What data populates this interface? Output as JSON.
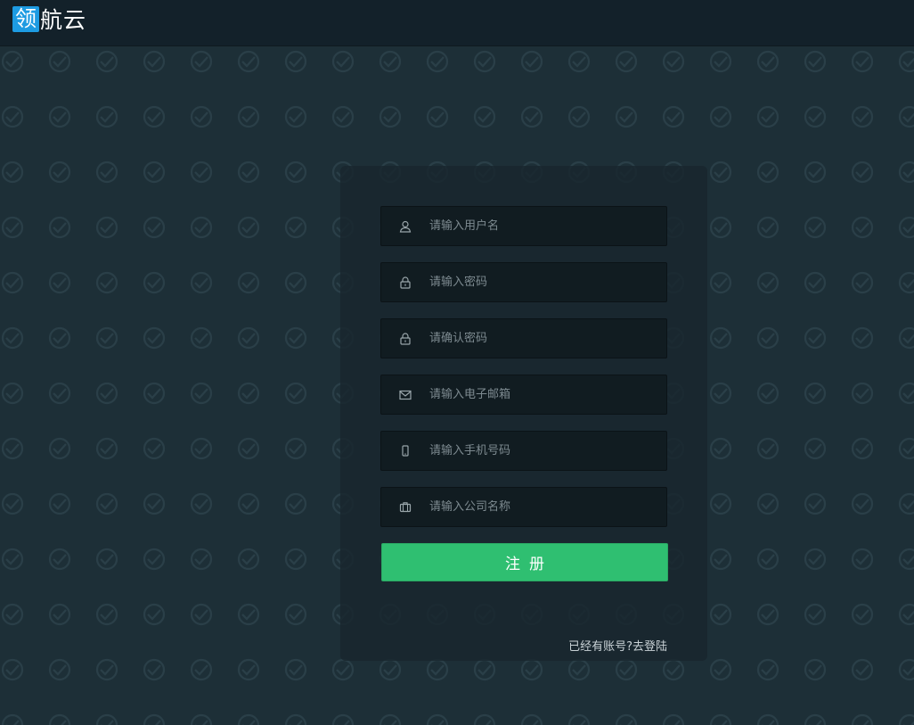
{
  "header": {
    "logo_mark": "领",
    "logo_text": "航云"
  },
  "form": {
    "fields": [
      {
        "icon": "user-icon",
        "placeholder": "请输入用户名",
        "value": ""
      },
      {
        "icon": "lock-icon",
        "placeholder": "请输入密码",
        "value": ""
      },
      {
        "icon": "lock-icon",
        "placeholder": "请确认密码",
        "value": ""
      },
      {
        "icon": "envelope-icon",
        "placeholder": "请输入电子邮箱",
        "value": ""
      },
      {
        "icon": "mobile-phone-icon",
        "placeholder": "请输入手机号码",
        "value": ""
      },
      {
        "icon": "briefcase-icon",
        "placeholder": "请输入公司名称",
        "value": ""
      }
    ],
    "submit_label": "注册",
    "login_link": "已经有账号?去登陆"
  },
  "colors": {
    "background": "#1d2f37",
    "accent": "#2fbf71",
    "logo_blue": "#1d9be2"
  }
}
